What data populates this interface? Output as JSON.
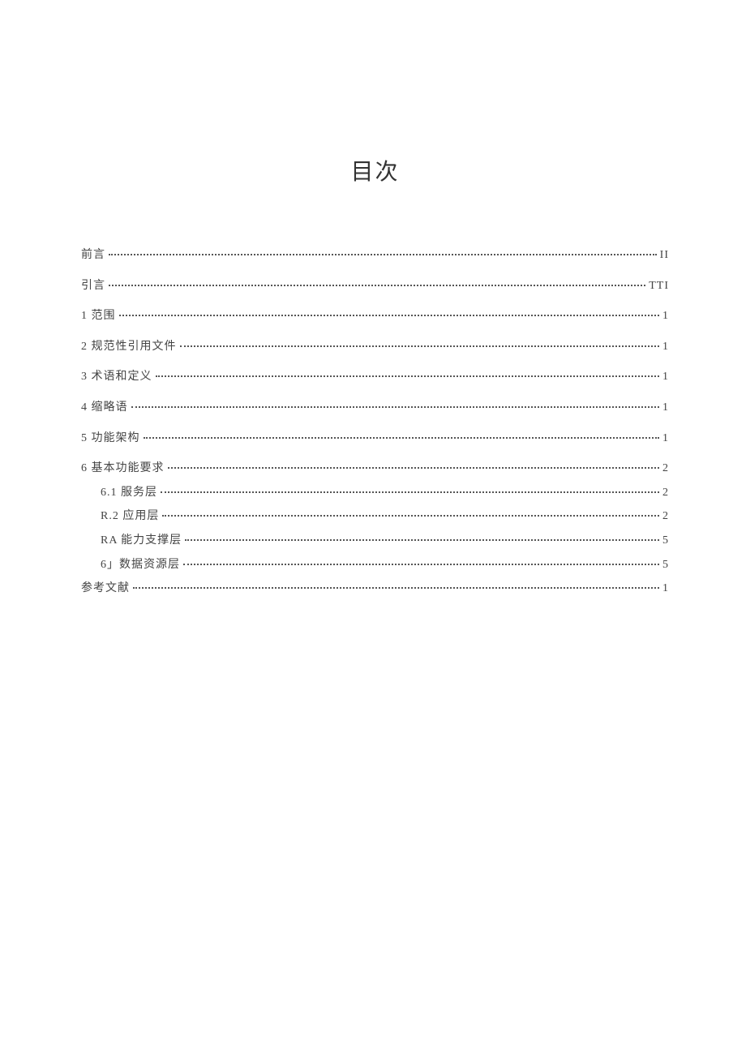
{
  "title": "目次",
  "entries": [
    {
      "label": "前言",
      "page": "II",
      "indent": 0
    },
    {
      "label": "引言",
      "page": "TTI",
      "indent": 0
    },
    {
      "label": "1 范围",
      "page": "1",
      "indent": 0
    },
    {
      "label": "2 规范性引用文件",
      "page": "1",
      "indent": 0
    },
    {
      "label": "3 术语和定义",
      "page": "1",
      "indent": 0
    },
    {
      "label": "4 缩略语",
      "page": "1",
      "indent": 0
    },
    {
      "label": "5 功能架构",
      "page": "1",
      "indent": 0
    },
    {
      "label": "6 基本功能要求",
      "page": "2",
      "indent": 0
    },
    {
      "label": "6.1 服务层",
      "page": "2",
      "indent": 1
    },
    {
      "label": "R.2 应用层",
      "page": "2",
      "indent": 1
    },
    {
      "label": "RA 能力支撑层",
      "page": "5",
      "indent": 1
    },
    {
      "label": "6」数据资源层",
      "page": "5",
      "indent": 1
    },
    {
      "label": "参考文献",
      "page": "1",
      "indent": 0
    }
  ]
}
